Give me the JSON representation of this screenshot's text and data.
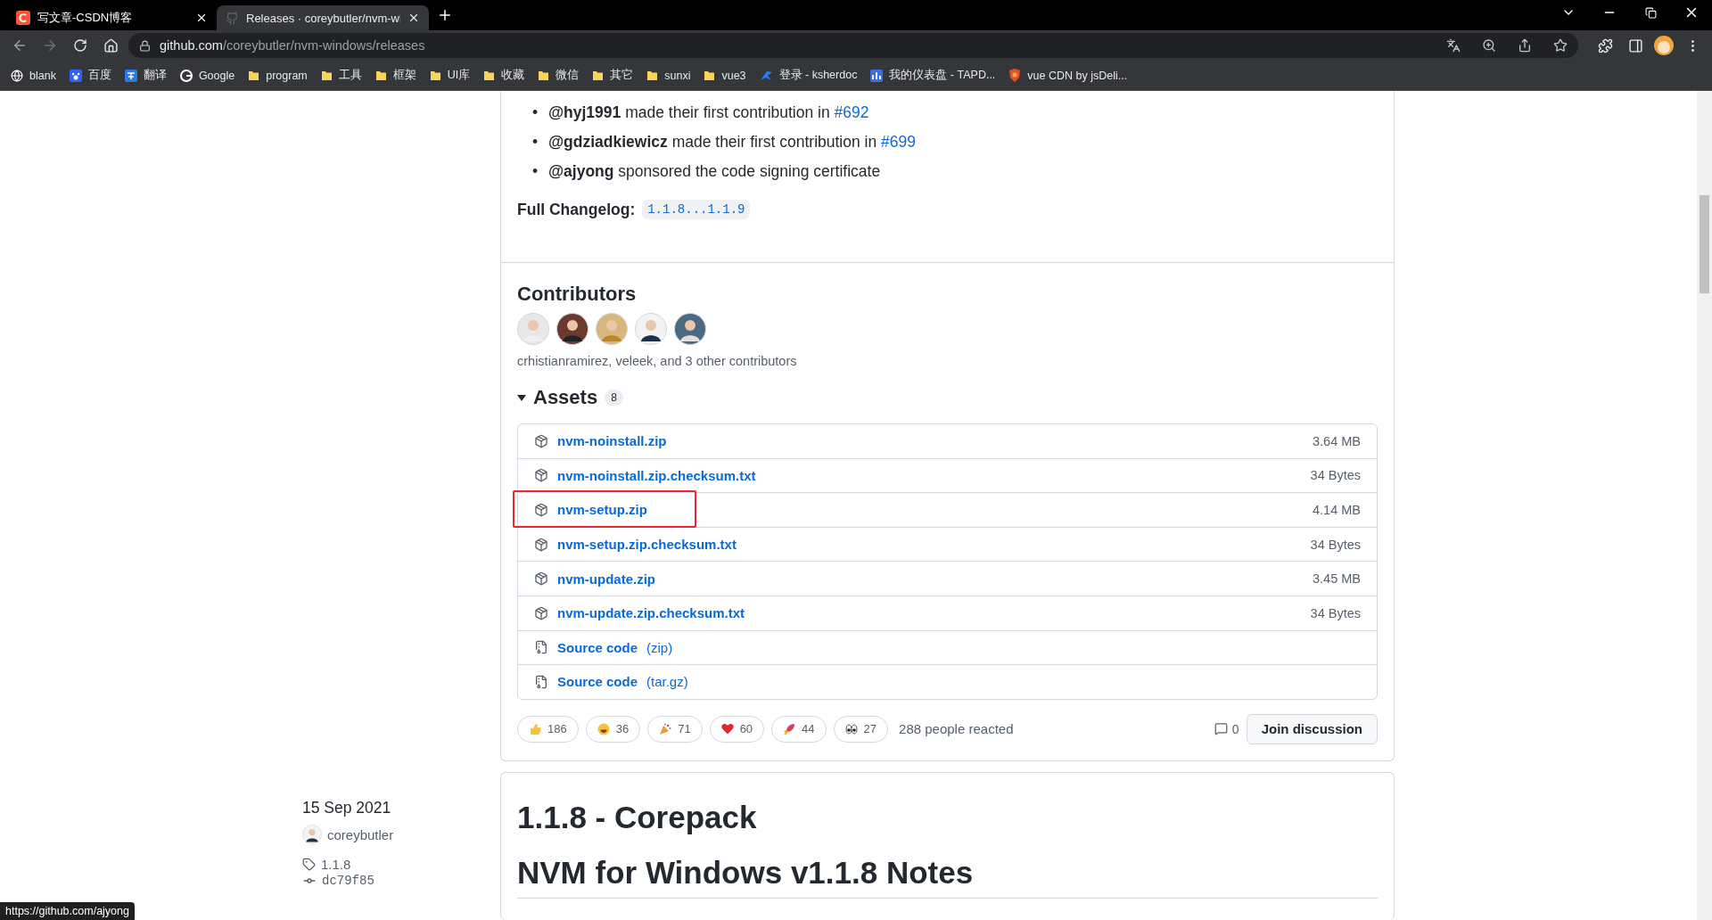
{
  "browser": {
    "tabs": [
      {
        "title": "写文章-CSDN博客",
        "kind": "csdn",
        "selected": false
      },
      {
        "title": "Releases · coreybutler/nvm-wi",
        "kind": "github",
        "selected": true
      }
    ],
    "url_host": "github.com",
    "url_path": "/coreybutler/nvm-windows/releases",
    "bookmarks": [
      {
        "label": "blank",
        "kind": "globe"
      },
      {
        "label": "百度",
        "kind": "paw"
      },
      {
        "label": "翻译",
        "kind": "translate"
      },
      {
        "label": "Google",
        "kind": "google"
      },
      {
        "label": "program",
        "kind": "folder"
      },
      {
        "label": "工具",
        "kind": "folder"
      },
      {
        "label": "框架",
        "kind": "folder"
      },
      {
        "label": "UI库",
        "kind": "folder"
      },
      {
        "label": "收藏",
        "kind": "folder"
      },
      {
        "label": "微信",
        "kind": "folder"
      },
      {
        "label": "其它",
        "kind": "folder"
      },
      {
        "label": "sunxi",
        "kind": "folder"
      },
      {
        "label": "vue3",
        "kind": "folder"
      },
      {
        "label": "登录 - ksherdoc",
        "kind": "bird"
      },
      {
        "label": "我的仪表盘 - TAPD...",
        "kind": "tapd"
      },
      {
        "label": "vue CDN by jsDeli...",
        "kind": "shield"
      }
    ]
  },
  "release": {
    "contributions": [
      {
        "marker": "•",
        "user": "@hyj1991",
        "text": "made their first contribution in",
        "link": "#692"
      },
      {
        "marker": "•",
        "user": "@gdziadkiewicz",
        "text": "made their first contribution in",
        "link": "#699"
      },
      {
        "marker": "•",
        "user": "@ajyong",
        "text": "sponsored the code signing certificate"
      }
    ],
    "changelog_label": "Full Changelog:",
    "changelog_link": "1.1.8...1.1.9",
    "contributors_title": "Contributors",
    "contributor_avatars": [
      {
        "kind": "avatar"
      },
      {
        "kind": "avatar"
      },
      {
        "kind": "avatar"
      },
      {
        "kind": "avatar"
      },
      {
        "kind": "avatar"
      }
    ],
    "contributors_text": "crhistianramirez, veleek, and 3 other contributors",
    "assets_title": "Assets",
    "assets_count": "8",
    "assets_expanded": true,
    "assets": [
      {
        "kind": "package",
        "name": "nvm-noinstall.zip",
        "size": "3.64 MB",
        "highlighted": false
      },
      {
        "kind": "package",
        "name": "nvm-noinstall.zip.checksum.txt",
        "size": "34 Bytes",
        "highlighted": false
      },
      {
        "kind": "package",
        "name": "nvm-setup.zip",
        "size": "4.14 MB",
        "highlighted": true
      },
      {
        "kind": "package",
        "name": "nvm-setup.zip.checksum.txt",
        "size": "34 Bytes",
        "highlighted": false
      },
      {
        "kind": "package",
        "name": "nvm-update.zip",
        "size": "3.45 MB",
        "highlighted": false
      },
      {
        "kind": "package",
        "name": "nvm-update.zip.checksum.txt",
        "size": "34 Bytes",
        "highlighted": false
      },
      {
        "kind": "source",
        "name": "Source code",
        "format": "(zip)",
        "highlighted": false
      },
      {
        "kind": "source",
        "name": "Source code",
        "format": "(tar.gz)",
        "highlighted": false
      }
    ],
    "reactions": [
      {
        "kind": "thumbs-up",
        "count": "186"
      },
      {
        "kind": "laugh",
        "count": "36"
      },
      {
        "kind": "hooray",
        "count": "71"
      },
      {
        "kind": "heart",
        "count": "60"
      },
      {
        "kind": "rocket",
        "count": "44"
      },
      {
        "kind": "eyes",
        "count": "27"
      }
    ],
    "reacted_text": "288 people reacted",
    "comments": "0",
    "join_button": "Join discussion"
  },
  "next_release": {
    "date": "15 Sep 2021",
    "author": "coreybutler",
    "tag": "1.1.8",
    "commit": "dc79f85",
    "title": "1.1.8 - Corepack",
    "heading": "NVM for Windows v1.1.8 Notes"
  },
  "status_url": "https://github.com/ajyong"
}
